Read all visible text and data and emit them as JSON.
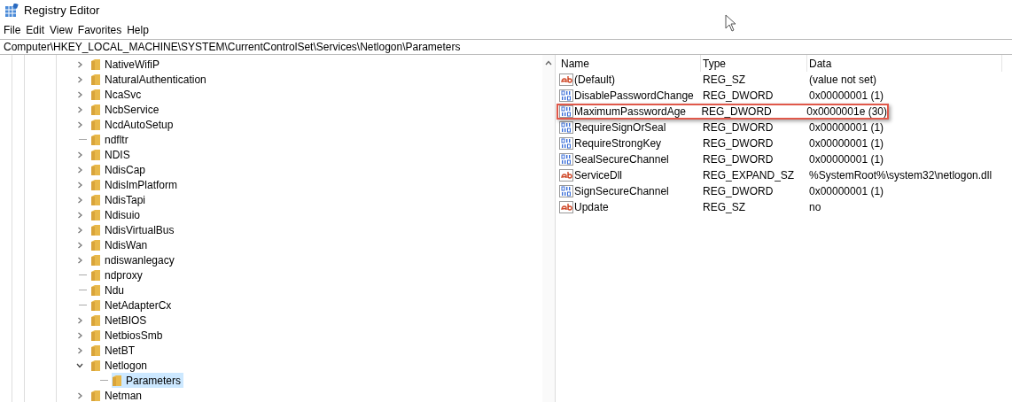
{
  "window": {
    "title": "Registry Editor"
  },
  "menu": [
    "File",
    "Edit",
    "View",
    "Favorites",
    "Help"
  ],
  "address": "Computer\\HKEY_LOCAL_MACHINE\\SYSTEM\\CurrentControlSet\\Services\\Netlogon\\Parameters",
  "tree": [
    {
      "label": "NativeWifiP",
      "kind": "branch",
      "expanded": false,
      "selected": false
    },
    {
      "label": "NaturalAuthentication",
      "kind": "branch",
      "expanded": false,
      "selected": false
    },
    {
      "label": "NcaSvc",
      "kind": "branch",
      "expanded": false,
      "selected": false
    },
    {
      "label": "NcbService",
      "kind": "branch",
      "expanded": false,
      "selected": false
    },
    {
      "label": "NcdAutoSetup",
      "kind": "branch",
      "expanded": false,
      "selected": false
    },
    {
      "label": "ndfltr",
      "kind": "leaf",
      "selected": false
    },
    {
      "label": "NDIS",
      "kind": "branch",
      "expanded": false,
      "selected": false
    },
    {
      "label": "NdisCap",
      "kind": "branch",
      "expanded": false,
      "selected": false
    },
    {
      "label": "NdisImPlatform",
      "kind": "branch",
      "expanded": false,
      "selected": false
    },
    {
      "label": "NdisTapi",
      "kind": "branch",
      "expanded": false,
      "selected": false
    },
    {
      "label": "Ndisuio",
      "kind": "branch",
      "expanded": false,
      "selected": false
    },
    {
      "label": "NdisVirtualBus",
      "kind": "branch",
      "expanded": false,
      "selected": false
    },
    {
      "label": "NdisWan",
      "kind": "branch",
      "expanded": false,
      "selected": false
    },
    {
      "label": "ndiswanlegacy",
      "kind": "branch",
      "expanded": false,
      "selected": false
    },
    {
      "label": "ndproxy",
      "kind": "leaf",
      "selected": false
    },
    {
      "label": "Ndu",
      "kind": "leaf",
      "selected": false
    },
    {
      "label": "NetAdapterCx",
      "kind": "leaf",
      "selected": false
    },
    {
      "label": "NetBIOS",
      "kind": "branch",
      "expanded": false,
      "selected": false
    },
    {
      "label": "NetbiosSmb",
      "kind": "branch",
      "expanded": false,
      "selected": false
    },
    {
      "label": "NetBT",
      "kind": "branch",
      "expanded": false,
      "selected": false
    },
    {
      "label": "Netlogon",
      "kind": "branch",
      "expanded": true,
      "selected": false,
      "children": [
        {
          "label": "Parameters",
          "kind": "leaf",
          "selected": true
        }
      ]
    },
    {
      "label": "Netman",
      "kind": "branch",
      "expanded": false,
      "selected": false
    }
  ],
  "table": {
    "columns": [
      "Name",
      "Type",
      "Data"
    ],
    "rows": [
      {
        "kind": "string",
        "name": "(Default)",
        "type": "REG_SZ",
        "data": "(value not set)",
        "highlighted": false
      },
      {
        "kind": "binary",
        "name": "DisablePasswordChange",
        "type": "REG_DWORD",
        "data": "0x00000001 (1)",
        "highlighted": false
      },
      {
        "kind": "binary",
        "name": "MaximumPasswordAge",
        "type": "REG_DWORD",
        "data": "0x0000001e (30)",
        "highlighted": true
      },
      {
        "kind": "binary",
        "name": "RequireSignOrSeal",
        "type": "REG_DWORD",
        "data": "0x00000001 (1)",
        "highlighted": false
      },
      {
        "kind": "binary",
        "name": "RequireStrongKey",
        "type": "REG_DWORD",
        "data": "0x00000001 (1)",
        "highlighted": false
      },
      {
        "kind": "binary",
        "name": "SealSecureChannel",
        "type": "REG_DWORD",
        "data": "0x00000001 (1)",
        "highlighted": false
      },
      {
        "kind": "string",
        "name": "ServiceDll",
        "type": "REG_EXPAND_SZ",
        "data": "%SystemRoot%\\system32\\netlogon.dll",
        "highlighted": false
      },
      {
        "kind": "binary",
        "name": "SignSecureChannel",
        "type": "REG_DWORD",
        "data": "0x00000001 (1)",
        "highlighted": false
      },
      {
        "kind": "string",
        "name": "Update",
        "type": "REG_SZ",
        "data": "no",
        "highlighted": false
      }
    ]
  }
}
